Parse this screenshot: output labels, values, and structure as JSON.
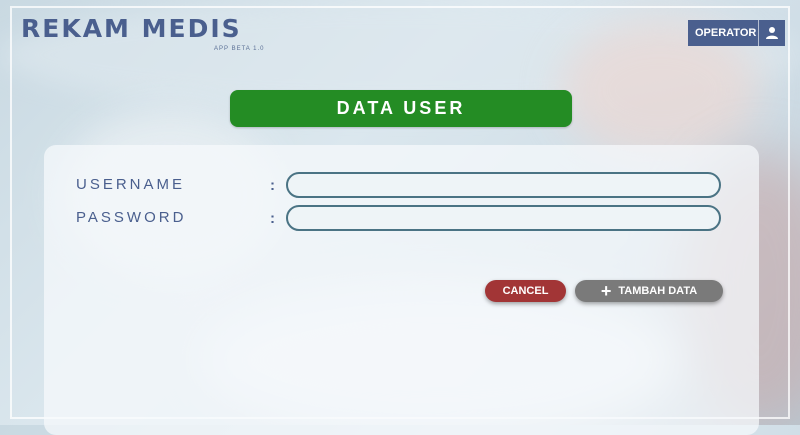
{
  "app": {
    "title": "REKAM MEDIS",
    "version": "APP BETA 1.0"
  },
  "header": {
    "operator_label": "OPERATOR",
    "operator_icon": "user-icon"
  },
  "page": {
    "title": "DATA USER"
  },
  "form": {
    "fields": [
      {
        "label": "USERNAME",
        "colon": ":",
        "value": ""
      },
      {
        "label": "PASSWORD",
        "colon": ":",
        "value": ""
      }
    ],
    "cancel_label": "CANCEL",
    "add_label": "TAMBAH DATA",
    "add_icon": "plus-icon"
  },
  "colors": {
    "brand": "#4a5f8e",
    "title_bar": "#248c24",
    "cancel": "#a23536",
    "add": "#7a7a7a",
    "input_border": "#4a7384"
  }
}
